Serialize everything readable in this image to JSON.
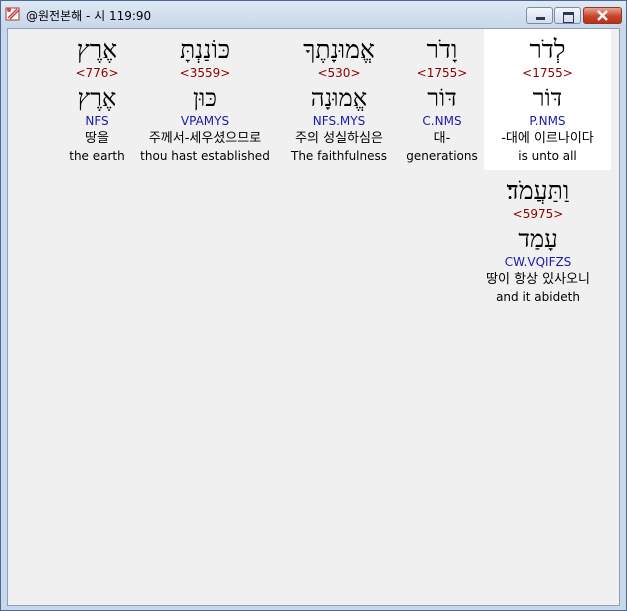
{
  "window": {
    "title": "@원전본해 - 시 119:90"
  },
  "words": [
    {
      "hebrew": "לְדֹר",
      "strong": "<1755>",
      "lemma": "דּוֹר",
      "morph": "P.NMS",
      "korean": "-대에 이르나이다",
      "english": "is unto all",
      "selected": true
    },
    {
      "hebrew": "וָדֹר",
      "strong": "<1755>",
      "lemma": "דּוֹר",
      "morph": "C.NMS",
      "korean": "대-",
      "english": "generations"
    },
    {
      "hebrew": "אֱמוּנָתֶךָ",
      "strong": "<530>",
      "lemma": "אֱמוּנָה",
      "morph": "NFS.MYS",
      "korean": "주의 성실하심은",
      "english": "The faithfulness"
    },
    {
      "hebrew": "כּוֹנַנְתָּ",
      "strong": "<3559>",
      "lemma": "כּוּן",
      "morph": "VPAMYS",
      "korean": "주께서-세우셨으므로",
      "english": "thou hast established"
    },
    {
      "hebrew": "אֶרֶץ",
      "strong": "<776>",
      "lemma": "אֶרֶץ",
      "morph": "NFS",
      "korean": "땅을",
      "english": "the earth"
    },
    {
      "hebrew": "וַתַּעֲמֹד׃",
      "strong": "<5975>",
      "lemma": "עָמַד",
      "morph": "CW.VQIFZS",
      "korean": "땅이 항상 있사오니",
      "english": "and it abideth"
    }
  ]
}
